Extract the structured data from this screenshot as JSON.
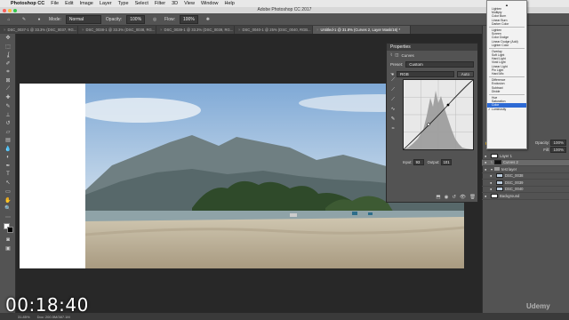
{
  "menubar": {
    "app_name": "Photoshop CC",
    "items": [
      "File",
      "Edit",
      "Image",
      "Layer",
      "Type",
      "Select",
      "Filter",
      "3D",
      "View",
      "Window",
      "Help"
    ]
  },
  "window": {
    "title": "Adobe Photoshop CC 2017"
  },
  "options_bar": {
    "mode_label": "Mode:",
    "mode_value": "Normal",
    "opacity_label": "Opacity:",
    "opacity_value": "100%",
    "flow_label": "Flow:",
    "flow_value": "100%"
  },
  "doc_tabs": [
    "DSC_0037-1 @ 33.3% (DSC_0037, RG...",
    "DSC_0038-1 @ 33.3% (DSC_0038, RG...",
    "DSC_0039-1 @ 33.3% (DSC_0039, RG...",
    "DSC_0040-1 @ 25% (DSC_0040, RGB...",
    "Untitled-1 @ 31.8% (Curves 2, Layer Mask/16) *"
  ],
  "properties": {
    "panel_title": "Properties",
    "adjustment_name": "Curves",
    "preset_label": "Preset:",
    "preset_value": "Custom",
    "channel_value": "RGB",
    "auto_label": "Auto",
    "input_label": "Input:",
    "input_value": "93",
    "output_label": "Output:",
    "output_value": "101"
  },
  "blend_menu": {
    "items": [
      "Lighten",
      "Multiply",
      "Color Burn",
      "Linear Burn",
      "Darker Color",
      "---",
      "Lighten",
      "Screen",
      "Color Dodge",
      "Linear Dodge (Add)",
      "Lighter Color",
      "---",
      "Overlay",
      "Soft Light",
      "Hard Light",
      "Vivid Light",
      "Linear Light",
      "Pin Light",
      "Hard Mix",
      "---",
      "Difference",
      "Exclusion",
      "Subtract",
      "Divide",
      "---",
      "Hue",
      "Saturation",
      "Color",
      "Luminosity"
    ],
    "selected": "Color",
    "checked": "Luminosity"
  },
  "layers_panel": {
    "opacity_label": "Opacity:",
    "opacity_value": "100%",
    "fill_label": "Fill:",
    "fill_value": "100%",
    "layers": [
      {
        "name": "Layer 1",
        "thumb": "white"
      },
      {
        "name": "Curves 2",
        "thumb": "dark"
      },
      {
        "name": "test layer",
        "thumb": "folder"
      },
      {
        "name": "DSC_0038",
        "thumb": "photo"
      },
      {
        "name": "DSC_0039",
        "thumb": "photo"
      },
      {
        "name": "DSC_0040",
        "thumb": "photo"
      },
      {
        "name": "Background",
        "thumb": "white"
      }
    ],
    "selected_layer": "Curves 2"
  },
  "status": {
    "zoom": "31.85%",
    "doc_size": "Doc: 200.5M/387.1M"
  },
  "overlay": {
    "timecode": "00:18:40",
    "watermark": "Udemy"
  },
  "colors": {
    "panel_bg": "#535353",
    "canvas_bg": "#282828",
    "menu_highlight": "#2e6ad4"
  }
}
